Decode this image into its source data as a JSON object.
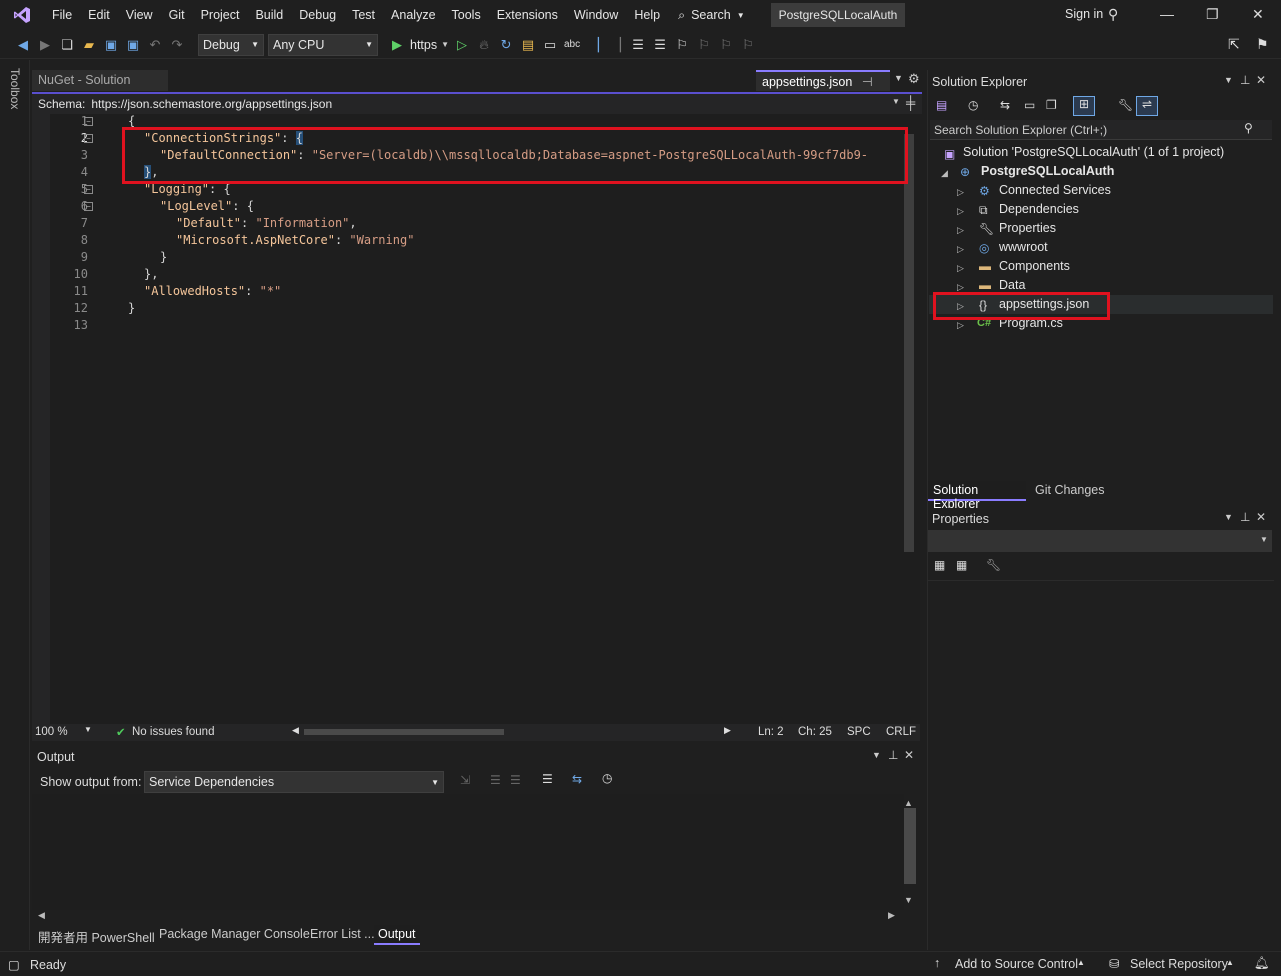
{
  "title_bar": {
    "menu": [
      "File",
      "Edit",
      "View",
      "Git",
      "Project",
      "Build",
      "Debug",
      "Test",
      "Analyze",
      "Tools",
      "Extensions",
      "Window",
      "Help"
    ],
    "search_label": "Search",
    "project_name": "PostgreSQLLocalAuth",
    "sign_in": "Sign in"
  },
  "toolbar": {
    "config": "Debug",
    "platform": "Any CPU",
    "run_profile": "https"
  },
  "toolbox_label": "Toolbox",
  "doc_tabs": {
    "inactive": "NuGet - Solution",
    "active": "appsettings.json"
  },
  "schema": {
    "label": "Schema:",
    "url": "https://json.schemastore.org/appsettings.json"
  },
  "editor": {
    "line_numbers": [
      "1",
      "2",
      "3",
      "4",
      "5",
      "6",
      "7",
      "8",
      "9",
      "10",
      "11",
      "12",
      "13"
    ],
    "lines": {
      "l2_key": "\"ConnectionStrings\"",
      "l3_key": "\"DefaultConnection\"",
      "l3_value": "\"Server=(localdb)\\\\mssqllocaldb;Database=aspnet-PostgreSQLLocalAuth-99cf7db9-",
      "l5_key": "\"Logging\"",
      "l6_key": "\"LogLevel\"",
      "l7_key": "\"Default\"",
      "l7_value": "\"Information\"",
      "l8_key": "\"Microsoft.AspNetCore\"",
      "l8_value": "\"Warning\"",
      "l11_key": "\"AllowedHosts\"",
      "l11_value": "\"*\""
    }
  },
  "editor_status": {
    "zoom": "100 %",
    "issues": "No issues found",
    "line": "Ln: 2",
    "col": "Ch: 25",
    "spacing": "SPC",
    "eol": "CRLF"
  },
  "output": {
    "title": "Output",
    "show_from_label": "Show output from:",
    "source": "Service Dependencies"
  },
  "bottom_tabs": [
    "開発者用 PowerShell",
    "Package Manager Console",
    "Error List ...",
    "Output"
  ],
  "status_bar": {
    "ready": "Ready",
    "add_source_control": "Add to Source Control",
    "select_repo": "Select Repository"
  },
  "solution_explorer": {
    "title": "Solution Explorer",
    "search_placeholder": "Search Solution Explorer (Ctrl+;)",
    "solution": "Solution 'PostgreSQLLocalAuth' (1 of 1 project)",
    "project": "PostgreSQLLocalAuth",
    "items": [
      "Connected Services",
      "Dependencies",
      "Properties",
      "wwwroot",
      "Components",
      "Data",
      "appsettings.json",
      "Program.cs"
    ],
    "tab_se": "Solution Explorer",
    "tab_git": "Git Changes"
  },
  "properties": {
    "title": "Properties"
  }
}
